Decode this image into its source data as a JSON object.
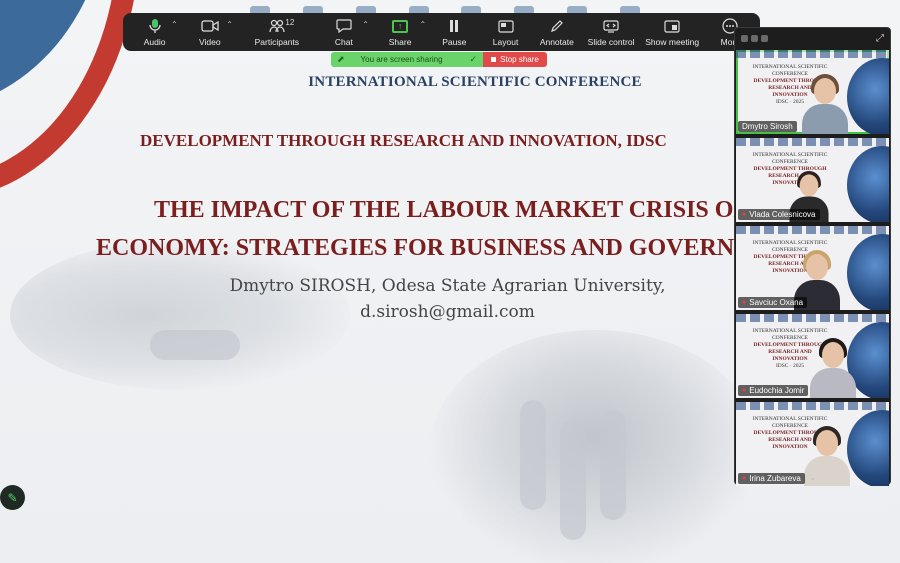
{
  "slide": {
    "conference_title": "INTERNATIONAL SCIENTIFIC CONFERENCE",
    "conference_subtitle": "DEVELOPMENT THROUGH RESEARCH AND INNOVATION, IDSC",
    "paper_title_line1": "THE IMPACT OF THE LABOUR MARKET CRISIS ON",
    "paper_title_line2": "ECONOMY: STRATEGIES FOR BUSINESS AND GOVERN",
    "author_line1": "Dmytro SIROSH, Odesa State Agrarian University,",
    "author_line2": "d.sirosh@gmail.com",
    "accent_blue": "#3b6a9b",
    "accent_red": "#c23a30",
    "title_color": "#7a1e1e"
  },
  "toolbar": {
    "audio": "Audio",
    "video": "Video",
    "participants": "Participants",
    "participants_count": "12",
    "chat": "Chat",
    "share": "Share",
    "pause": "Pause",
    "layout": "Layout",
    "annotate": "Annotate",
    "slide_control": "Slide control",
    "show_meeting": "Show meeting",
    "more": "More"
  },
  "banner": {
    "sharing_text": "You are screen sharing",
    "stop_share": "Stop share",
    "green": "#6ad46a",
    "red": "#e24a4a"
  },
  "tile_bg": {
    "line1": "INTERNATIONAL SCIENTIFIC",
    "line2": "CONFERENCE",
    "line3": "DEVELOPMENT THROUGH",
    "line4": "RESEARCH AND INNOVATION",
    "year": "IDSC · 2025"
  },
  "participants": [
    {
      "name": "Dmytro Sirosh",
      "active": true,
      "muted": false
    },
    {
      "name": "Vlada Colesnicova",
      "active": false,
      "muted": true
    },
    {
      "name": "Savciuc Oxana",
      "active": false,
      "muted": true
    },
    {
      "name": "Eudochia Jomir",
      "active": false,
      "muted": true
    },
    {
      "name": "Irina Zubareva",
      "active": false,
      "muted": true
    }
  ]
}
